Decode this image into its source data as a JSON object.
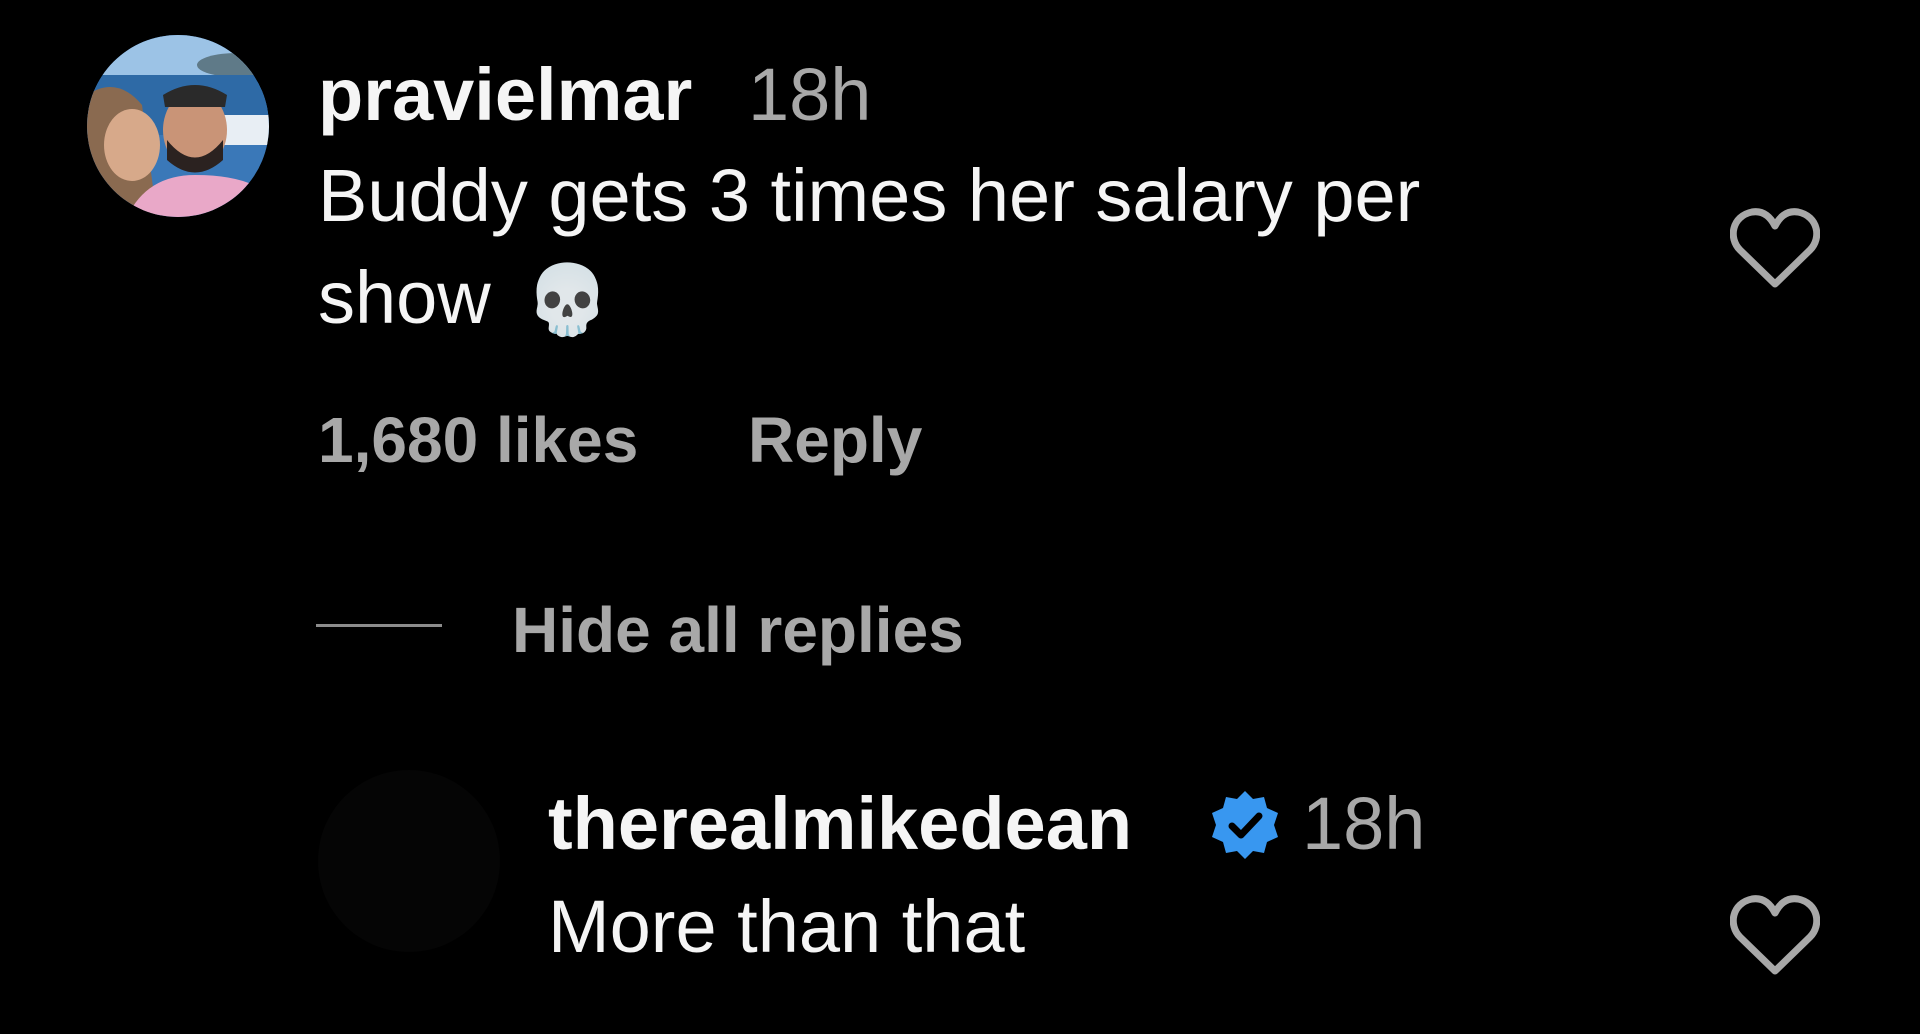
{
  "comment": {
    "username": "pravielmar",
    "time": "18h",
    "text_line1": "Buddy gets 3 times her salary per",
    "text_line2": "show",
    "emoji": "💀",
    "likes": "1,680 likes",
    "reply_label": "Reply",
    "like_icon": "heart-outline-icon"
  },
  "replies_toggle": {
    "label": "Hide all replies"
  },
  "reply": {
    "username": "therealmikedean",
    "verified_icon": "verified-badge-icon",
    "verified_color": "#3897f0",
    "time": "18h",
    "text": "More than that",
    "like_icon": "heart-outline-icon"
  },
  "colors": {
    "background": "#000000",
    "primary_text": "#f5f5f5",
    "secondary_text": "#a8a8a8"
  }
}
